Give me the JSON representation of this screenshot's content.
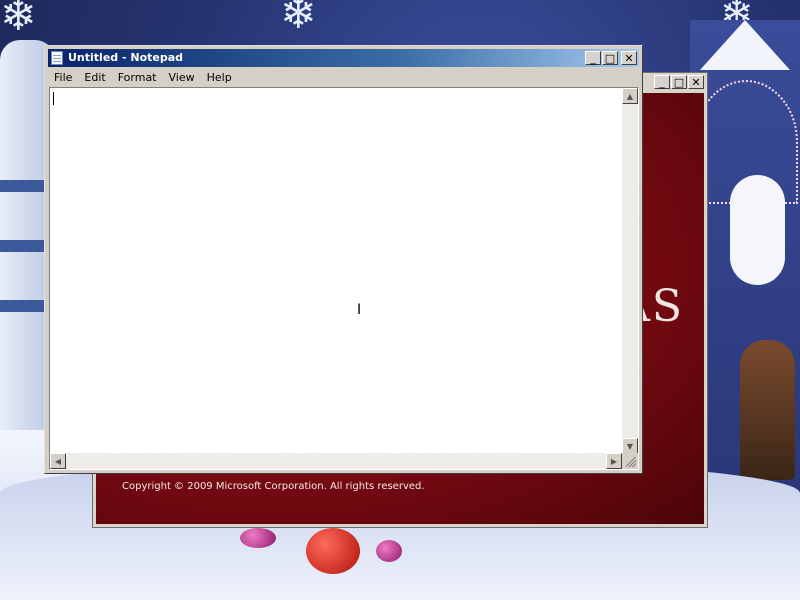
{
  "notepad": {
    "title": "Untitled - Notepad",
    "menu": [
      "File",
      "Edit",
      "Format",
      "View",
      "Help"
    ],
    "text": "",
    "caption": {
      "minimize": "_",
      "maximize": "□",
      "close": "✕"
    }
  },
  "background_window": {
    "banner_text": "AS",
    "copyright": "Copyright © 2009 Microsoft Corporation. All rights reserved.",
    "caption": {
      "minimize": "_",
      "maximize": "□",
      "close": "✕"
    }
  },
  "colors": {
    "title_bar_start": "#0a246a",
    "title_bar_end": "#a6caf0",
    "dialog_red": "#7a0a12"
  },
  "icons": [
    "notepad-app-icon",
    "minimize-icon",
    "maximize-icon",
    "close-icon",
    "scroll-up-icon",
    "scroll-down-icon",
    "scroll-left-icon",
    "scroll-right-icon",
    "resize-grip-icon",
    "ibeam-cursor-icon"
  ]
}
